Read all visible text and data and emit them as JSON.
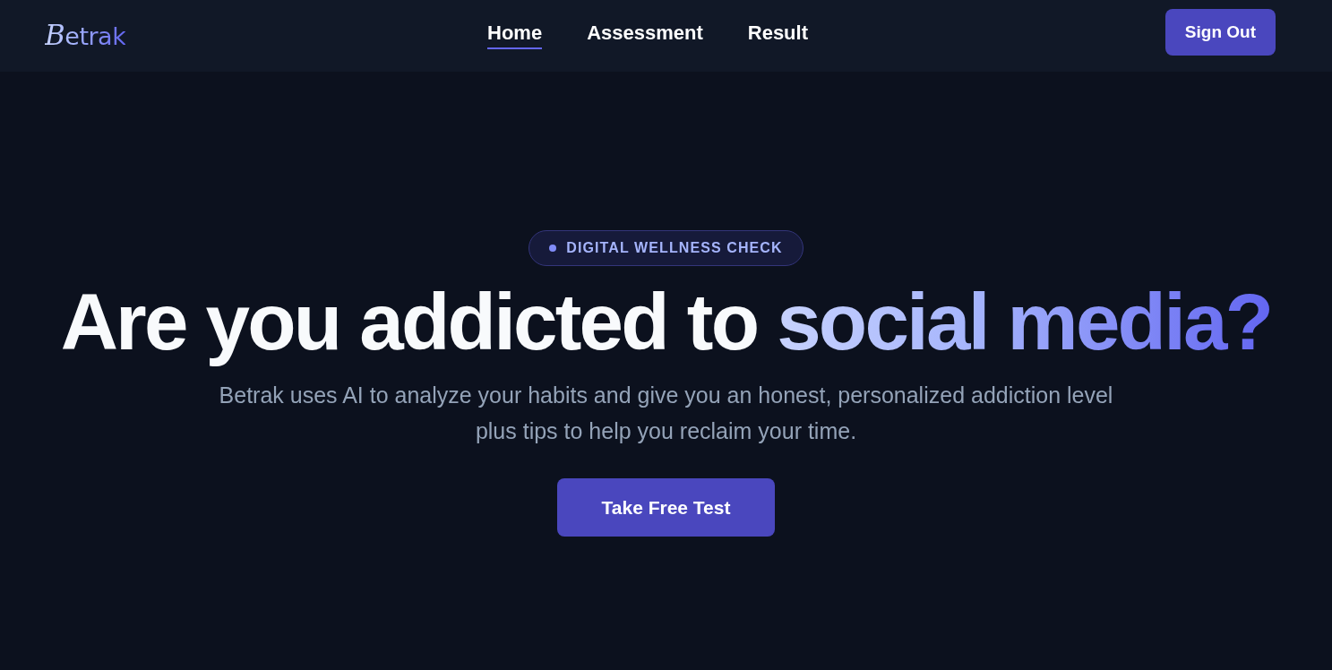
{
  "brand": {
    "name": "Betrak"
  },
  "nav": {
    "tabs": [
      {
        "label": "Home",
        "selected": true
      },
      {
        "label": "Assessment",
        "selected": false
      },
      {
        "label": "Result",
        "selected": false
      }
    ],
    "sign_out": "Sign Out"
  },
  "hero": {
    "badge": "DIGITAL WELLNESS CHECK",
    "heading": "Are you addicted to",
    "heading_highlight": "social media?",
    "subtitle": "Betrak uses AI to analyze your habits and give you an honest, personalized addiction level plus tips to help you reclaim your time.",
    "cta": "Take Free Test"
  }
}
